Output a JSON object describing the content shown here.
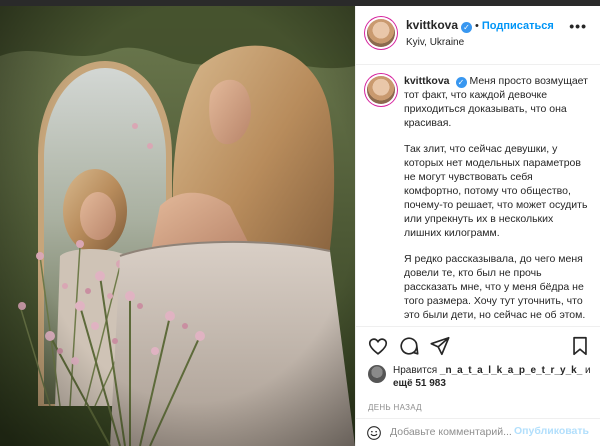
{
  "post": {
    "username": "kvittkova",
    "follow_label": "Подписаться",
    "separator": "•",
    "location": "Kyiv, Ukraine",
    "more_glyph": "•••",
    "verified_glyph": "✓"
  },
  "caption": {
    "username": "kvittkova",
    "paragraphs": [
      "Меня просто возмущает тот факт, что каждой девочке приходиться доказывать, что она красивая.",
      "Так злит, что сейчас девушки, у которых нет модельных параметров не могут чувствовать себя комфортно, потому что общество, почему-то решает, что может осудить или упрекнуть их в нескольких лишних килограмм.",
      "Я редко рассказывала, до чего меня довели те, кто был не прочь рассказать мне, что у меня бёдра не того размера. Хочу тут уточнить, что это были дети, но сейчас не об этом."
    ]
  },
  "likes": {
    "prefix": "Нравится",
    "liker": "_n_a_t_a_l_k_a_p_e_t_r_y_k_",
    "middle": "и",
    "more": "ещё 51 983"
  },
  "date": "ДЕНЬ НАЗАД",
  "comment_box": {
    "placeholder": "Добавьте комментарий...",
    "post_label": "Опубликовать"
  },
  "icons": {
    "like": "heart-icon",
    "comment": "comment-icon",
    "share": "share-icon",
    "save": "bookmark-icon",
    "emoji": "smile-icon",
    "more": "more-icon",
    "verified": "verified-icon"
  },
  "colors": {
    "accent": "#0095f6",
    "verified": "#3897f0",
    "muted": "#8e8e8e",
    "text": "#262626",
    "post_disabled": "#b2dffc"
  }
}
